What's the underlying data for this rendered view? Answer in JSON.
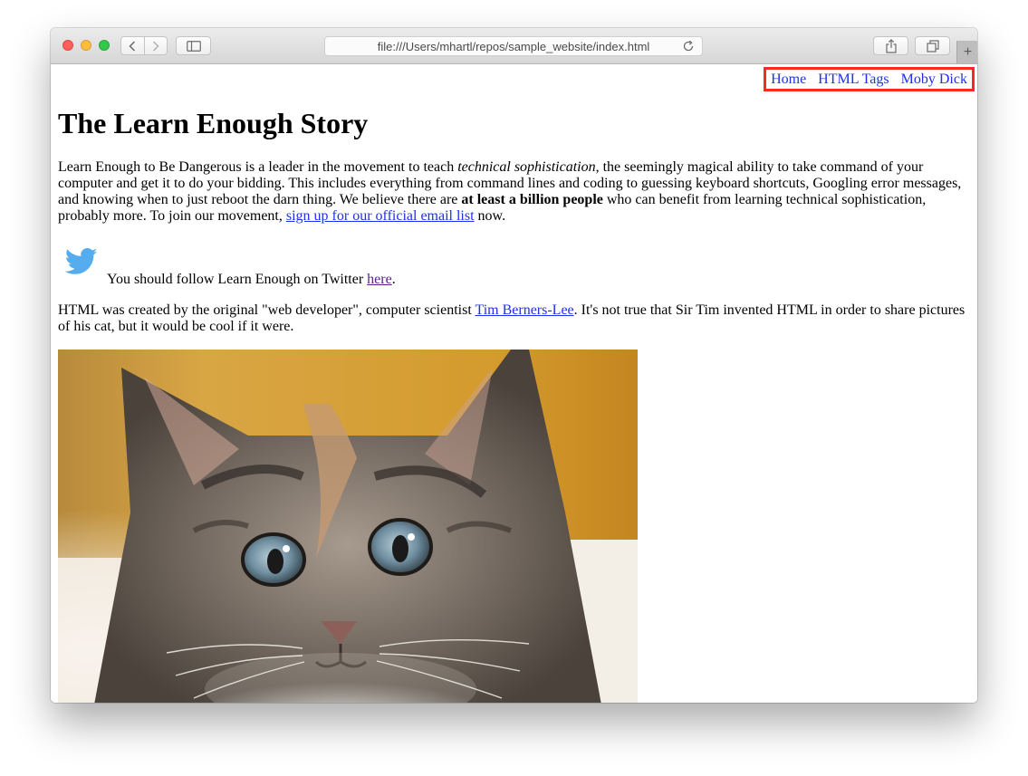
{
  "browser": {
    "address_url": "file:///Users/mhartl/repos/sample_website/index.html",
    "new_tab_label": "+"
  },
  "nav": {
    "items": [
      {
        "label": "Home"
      },
      {
        "label": "HTML Tags"
      },
      {
        "label": "Moby Dick"
      }
    ],
    "highlight_color": "#f42d1a"
  },
  "page": {
    "title": "The Learn Enough Story",
    "intro": {
      "t1": "Learn Enough to Be Dangerous is a leader in the movement to teach ",
      "em": "technical sophistication",
      "t2": ", the seemingly magical ability to take command of your computer and get it to do your bidding. This includes everything from command lines and coding to guessing keyboard shortcuts, Googling error messages, and knowing when to just reboot the darn thing. We believe there are ",
      "strong": "at least a billion people",
      "t3": " who can benefit from learning technical sophistication, probably more. To join our movement, ",
      "link": "sign up for our official email list",
      "t4": " now."
    },
    "twitter": {
      "text": "You should follow Learn Enough on Twitter ",
      "link": "here",
      "end": ".",
      "icon": "twitter-bird-icon",
      "icon_color": "#55acee"
    },
    "html_para": {
      "t1": "HTML was created by the original \"web developer\", computer scientist ",
      "link": "Tim Berners-Lee",
      "t2": ". It's not true that Sir Tim invented HTML in order to share pictures of his cat, but it would be cool if it were."
    },
    "image": "kitten-photo"
  },
  "colors": {
    "link": "#1f31e6",
    "visited_link": "#5a1f8a"
  }
}
